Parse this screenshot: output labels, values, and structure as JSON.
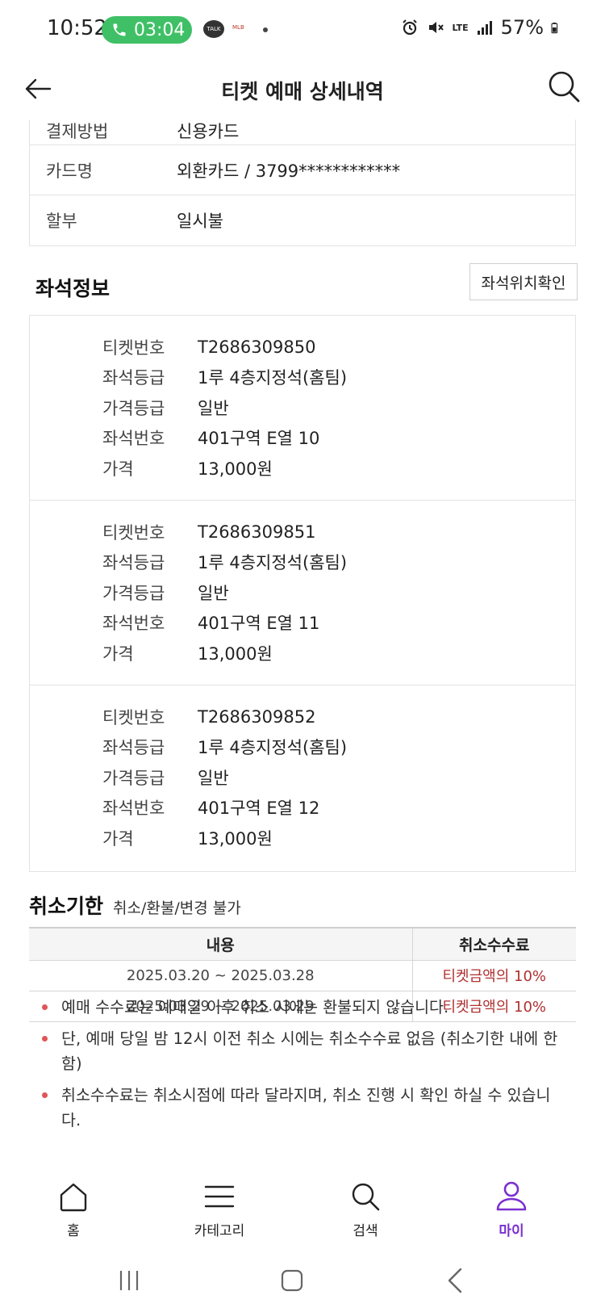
{
  "status_bar": {
    "time": "10:52",
    "call_timer": "03:04",
    "talk_badge": "TALK",
    "mini_app_badge": "MLB",
    "network": "LTE",
    "battery": "57%"
  },
  "header": {
    "title": "티켓 예매 상세내역"
  },
  "payment": {
    "rows": [
      {
        "label": "결제방법",
        "value": "신용카드"
      },
      {
        "label": "카드명",
        "value": "외환카드 / 3799************"
      },
      {
        "label": "할부",
        "value": "일시불"
      }
    ]
  },
  "seat_info": {
    "heading": "좌석정보",
    "location_button": "좌석위치확인",
    "field_labels": {
      "ticket_no": "티켓번호",
      "seat_grade": "좌석등급",
      "price_grade": "가격등급",
      "seat_no": "좌석번호",
      "price": "가격"
    },
    "tickets": [
      {
        "ticket_no": "T2686309850",
        "seat_grade": "1루 4층지정석(홈팀)",
        "price_grade": "일반",
        "seat_no": "401구역 E열 10",
        "price": "13,000원"
      },
      {
        "ticket_no": "T2686309851",
        "seat_grade": "1루 4층지정석(홈팀)",
        "price_grade": "일반",
        "seat_no": "401구역 E열 11",
        "price": "13,000원"
      },
      {
        "ticket_no": "T2686309852",
        "seat_grade": "1루 4층지정석(홈팀)",
        "price_grade": "일반",
        "seat_no": "401구역 E열 12",
        "price": "13,000원"
      }
    ]
  },
  "cancel": {
    "title": "취소기한",
    "note": "취소/환불/변경 불가",
    "table": {
      "headers": [
        "내용",
        "취소수수료"
      ],
      "rows": [
        [
          "2025.03.20 ~ 2025.03.28",
          "티켓금액의 10%"
        ],
        [
          "2025.03.29 ~ 2025.03.29",
          "티켓금액의 10%"
        ]
      ]
    },
    "notes": [
      "예매 수수료는 예매일 이후 취소 시에는 환불되지 않습니다.",
      "단, 예매 당일 밤 12시 이전 취소 시에는 취소수수료 없음 (취소기한 내에 한함)",
      "취소수수료는 취소시점에 따라 달라지며, 취소 진행 시 확인 하실 수 있습니다."
    ]
  },
  "bottom_nav": {
    "items": [
      {
        "label": "홈",
        "icon": "home-icon"
      },
      {
        "label": "카테고리",
        "icon": "menu-icon"
      },
      {
        "label": "검색",
        "icon": "search-icon"
      },
      {
        "label": "마이",
        "icon": "user-icon",
        "active": true
      }
    ]
  },
  "colors": {
    "accent": "#7b2fd0",
    "call_green": "#3fc066",
    "fee_red": "#b03030",
    "bullet_red": "#e05555"
  }
}
